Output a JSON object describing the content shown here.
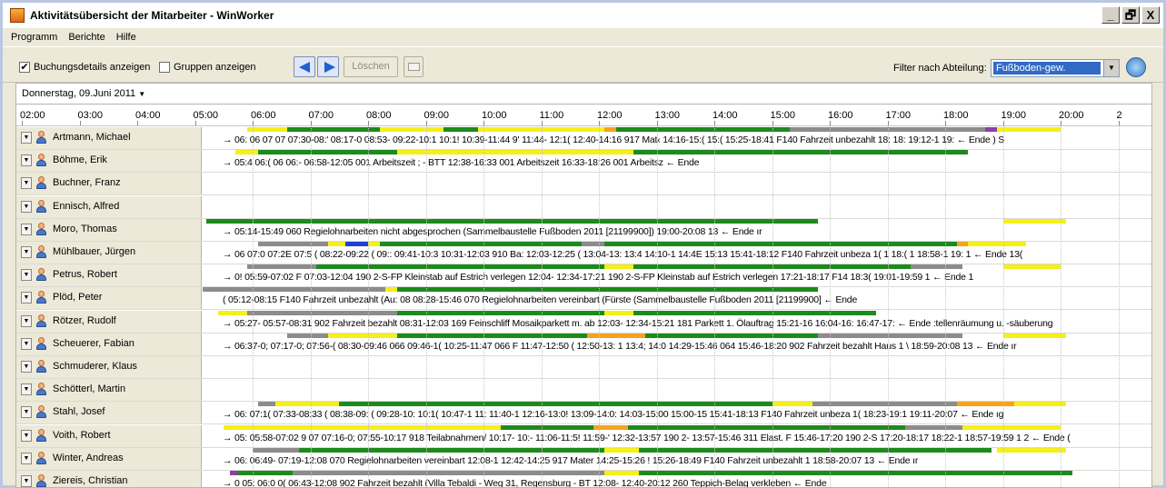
{
  "window": {
    "title": "Aktivitätsübersicht der Mitarbeiter - WinWorker",
    "controls": [
      "_",
      "🗗",
      "X"
    ]
  },
  "menu": [
    "Programm",
    "Berichte",
    "Hilfe"
  ],
  "toolbar": {
    "buchungsdetails_label": "Buchungsdetails anzeigen",
    "buchungsdetails_checked": true,
    "gruppen_label": "Gruppen anzeigen",
    "gruppen_checked": false,
    "loeschen_label": "Löschen",
    "filter_label": "Filter nach Abteilung:",
    "filter_value": "Fußboden-gew."
  },
  "date_label": "Donnerstag, 09.Juni 2011",
  "timeline": {
    "ticks": [
      "02:00",
      "03:00",
      "04:00",
      "05:00",
      "06:00",
      "07:00",
      "08:00",
      "09:00",
      "10:00",
      "11:00",
      "12:00",
      "13:00",
      "14:00",
      "15:00",
      "16:00",
      "17:00",
      "18:00",
      "19:00",
      "20:00",
      "2"
    ]
  },
  "colors": {
    "green": "#1d8a1d",
    "yellow": "#f5ef1a",
    "gray": "#8c8c8c",
    "orange": "#f7a21b",
    "purple": "#8d3fa6",
    "blue": "#2040d8"
  },
  "employees": [
    {
      "name": "Artmann, Michael",
      "text": "→  06: 06 07 07 07:30-08:' 08:17-0 08:53- 09:22-10:1  10:1! 10:39-11:44 9' 11:44- 12:1( 12:40-14:16 917 Mat‹ 14:16-15:( 15:( 15:25-18:41 F140 Fahrzeit unbezahlt            18: 18: 19:12-1 19:  ←  Ende  ) S",
      "bars": [
        {
          "c": "yellow",
          "s": 5.9,
          "e": 6.6
        },
        {
          "c": "green",
          "s": 6.6,
          "e": 8.2
        },
        {
          "c": "yellow",
          "s": 8.2,
          "e": 9.3
        },
        {
          "c": "green",
          "s": 9.3,
          "e": 9.9
        },
        {
          "c": "yellow",
          "s": 9.9,
          "e": 12.1
        },
        {
          "c": "orange",
          "s": 12.1,
          "e": 12.3
        },
        {
          "c": "green",
          "s": 12.3,
          "e": 15.3
        },
        {
          "c": "gray",
          "s": 15.3,
          "e": 18.7
        },
        {
          "c": "purple",
          "s": 18.7,
          "e": 18.9
        },
        {
          "c": "yellow",
          "s": 18.9,
          "e": 20
        }
      ]
    },
    {
      "name": "Böhme, Erik",
      "text": "→  05:4 06:( 06 06:- 06:58-12:05 001 Arbeitszeit                                                      ; - BTT  12:38-16:33 001 Arbeitszeit                              16:33-18:26 001 Arbeitsz ←  Ende",
      "bars": [
        {
          "c": "yellow",
          "s": 5.7,
          "e": 6.1
        },
        {
          "c": "green",
          "s": 6.1,
          "e": 8.5
        },
        {
          "c": "yellow",
          "s": 8.5,
          "e": 12.6
        },
        {
          "c": "green",
          "s": 12.6,
          "e": 18.4
        }
      ]
    },
    {
      "name": "Buchner, Franz",
      "text": "",
      "bars": []
    },
    {
      "name": "Ennisch, Alfred",
      "text": "",
      "bars": []
    },
    {
      "name": "Moro, Thomas",
      "text": "→ 05:14-15:49 060 Regielohnarbeiten nicht abgesprochen (Sammelbaustelle Fußboden 2011 [21199900])                                                                                                                  19:00-20:08 13 ←  Ende  ır",
      "bars": [
        {
          "c": "green",
          "s": 5.2,
          "e": 15.8
        },
        {
          "c": "yellow",
          "s": 19,
          "e": 20.1
        }
      ]
    },
    {
      "name": "Mühlbauer, Jürgen",
      "text": "→  06 07:0 07:2E 07:5 ( 08:22-09:22 ( 09:: 09:41-10:3 10:31-12:03 910 Ba: 12:03-12:25 ( 13:04-13: 13:4 14:10-1 14:4E 15:13 15:41-18:12 F140 Fahrzeit unbeza 1( 1 18:( 1 18:58-1 19: 1 ←  Ende  13(",
      "bars": [
        {
          "c": "gray",
          "s": 6.1,
          "e": 7.3
        },
        {
          "c": "yellow",
          "s": 7.3,
          "e": 7.6
        },
        {
          "c": "blue",
          "s": 7.6,
          "e": 8.0
        },
        {
          "c": "yellow",
          "s": 8.0,
          "e": 8.2
        },
        {
          "c": "green",
          "s": 8.2,
          "e": 11.7
        },
        {
          "c": "gray",
          "s": 11.7,
          "e": 12.1
        },
        {
          "c": "green",
          "s": 12.1,
          "e": 18.2
        },
        {
          "c": "orange",
          "s": 18.2,
          "e": 18.4
        },
        {
          "c": "yellow",
          "s": 18.4,
          "e": 19.4
        }
      ]
    },
    {
      "name": "Petrus, Robert",
      "text": "→  0! 05:59-07:02 F 07:03-12:04 190 2-S-FP Kleinstab auf Estrich verlegen                     12:04- 12:34-17:21 190 2-S-FP Kleinstab auf Estrich verlegen              17:21-18:17 F14 18:3( 19:01-19:59 1 ←  Ende  1",
      "bars": [
        {
          "c": "gray",
          "s": 5.9,
          "e": 7.1
        },
        {
          "c": "green",
          "s": 7.1,
          "e": 12.1
        },
        {
          "c": "yellow",
          "s": 12.1,
          "e": 12.6
        },
        {
          "c": "green",
          "s": 12.6,
          "e": 17.4
        },
        {
          "c": "gray",
          "s": 17.4,
          "e": 18.3
        },
        {
          "c": "yellow",
          "s": 19,
          "e": 20
        }
      ]
    },
    {
      "name": "Plöd, Peter",
      "text": "( 05:12-08:15 F140 Fahrzeit unbezahlt (Au: 08 08:28-15:46 070 Regielohnarbeiten vereinbart (Fürste (Sammelbaustelle Fußboden 2011 [21199900] ←  Ende",
      "bars": [
        {
          "c": "purple",
          "s": 5.0,
          "e": 5.05
        },
        {
          "c": "gray",
          "s": 5.1,
          "e": 8.3
        },
        {
          "c": "yellow",
          "s": 8.3,
          "e": 8.5
        },
        {
          "c": "green",
          "s": 8.5,
          "e": 15.8
        }
      ]
    },
    {
      "name": "Rötzer, Rudolf",
      "text": "→  05:27- 05:57-08:31 902 Fahrzeit bezahlt  08:31-12:03 169 Feinschliff Mosaikparkett m. ab 12:03- 12:34-15:21 181 Parkett 1. Ölauftrag  15:21-16 16:04-16: 16:47-17: ←  Ende  :tellenräumung u. -säuberung",
      "bars": [
        {
          "c": "yellow",
          "s": 5.4,
          "e": 5.9
        },
        {
          "c": "gray",
          "s": 5.9,
          "e": 8.5
        },
        {
          "c": "green",
          "s": 8.5,
          "e": 12.1
        },
        {
          "c": "yellow",
          "s": 12.1,
          "e": 12.6
        },
        {
          "c": "green",
          "s": 12.6,
          "e": 16.8
        }
      ]
    },
    {
      "name": "Scheuerer, Fabian",
      "text": "→  06:37-0; 07:17-0; 07:56-( 08:30-09:46 066 09:46-1( 10:25-11:47 066 F 11:47-12:50 ( 12:50-13: 1 13:4; 14:0 14:29-15:46 064  15:46-18:20 902 Fahrzeit bezahlt  Haus 1 \\ 18:59-20:08 13 ←  Ende  ır",
      "bars": [
        {
          "c": "gray",
          "s": 6.6,
          "e": 7.3
        },
        {
          "c": "yellow",
          "s": 7.3,
          "e": 8.5
        },
        {
          "c": "green",
          "s": 8.5,
          "e": 11.8
        },
        {
          "c": "orange",
          "s": 11.8,
          "e": 12.8
        },
        {
          "c": "green",
          "s": 12.8,
          "e": 15.8
        },
        {
          "c": "gray",
          "s": 15.8,
          "e": 18.3
        },
        {
          "c": "yellow",
          "s": 19,
          "e": 20.1
        }
      ]
    },
    {
      "name": "Schmuderer, Klaus",
      "text": "",
      "bars": []
    },
    {
      "name": "Schötterl, Martin",
      "text": "",
      "bars": []
    },
    {
      "name": "Stahl, Josef",
      "text": "→  06: 07:1( 07:33-08:33 ( 08:38-09: ( 09:28-10: 10:1( 10:47-1 11: 11:40-1 12:16-13:0! 13:09-14:0: 14:03-15:00  15:00-15 15:41-18:13 F140 Fahrzeit unbeza 1( 18:23-19:1 19:11-20:07 ←  Ende  ıg",
      "bars": [
        {
          "c": "gray",
          "s": 6.1,
          "e": 6.4
        },
        {
          "c": "yellow",
          "s": 6.4,
          "e": 7.5
        },
        {
          "c": "green",
          "s": 7.5,
          "e": 15.0
        },
        {
          "c": "yellow",
          "s": 15.0,
          "e": 15.7
        },
        {
          "c": "gray",
          "s": 15.7,
          "e": 18.2
        },
        {
          "c": "orange",
          "s": 18.2,
          "e": 19.2
        },
        {
          "c": "yellow",
          "s": 19.2,
          "e": 20.1
        }
      ]
    },
    {
      "name": "Voith, Robert",
      "text": "→  05: 05:58-07:02 9 07 07:16-0; 07:55-10:17 918 Teilabnahmen/ 10:17- 10:- 11:06-11:5! 11:59-' 12:32-13:57 190 2- 13:57-15:46 311 Elast. F 15:46-17:20 190 2-S 17:20-18:17  18:22-1 18:57-19:59 1 2 ←  Ende  (",
      "bars": [
        {
          "c": "yellow",
          "s": 5.5,
          "e": 10.3
        },
        {
          "c": "green",
          "s": 10.3,
          "e": 11.9
        },
        {
          "c": "orange",
          "s": 11.9,
          "e": 12.5
        },
        {
          "c": "green",
          "s": 12.5,
          "e": 17.3
        },
        {
          "c": "gray",
          "s": 17.3,
          "e": 18.3
        },
        {
          "c": "yellow",
          "s": 18.3,
          "e": 20
        }
      ]
    },
    {
      "name": "Winter, Andreas",
      "text": "→  06: 06:49- 07:19-12:08 070 Regielohnarbeiten vereinbart                                    12:08-1 12:42-14:25 917 Mater 14:25-15:26 ! 15:26-18:49 F140 Fahrzeit unbezahlt              1 18:58-20:07 13 ←  Ende  ır",
      "bars": [
        {
          "c": "gray",
          "s": 6.0,
          "e": 6.8
        },
        {
          "c": "green",
          "s": 6.8,
          "e": 12.1
        },
        {
          "c": "yellow",
          "s": 12.1,
          "e": 12.7
        },
        {
          "c": "green",
          "s": 12.7,
          "e": 18.8
        },
        {
          "c": "yellow",
          "s": 18.9,
          "e": 20.1
        }
      ]
    },
    {
      "name": "Ziereis, Christian",
      "text": "→  0 05: 06:0 0( 06:43-12:08 902 Fahrzeit bezahlt (Villa Tebaldi - Weg 31, Regensburg - BT 12:08- 12:40-20:12 260 Teppich-Belag verkleben                                                                    ←  Ende",
      "bars": [
        {
          "c": "purple",
          "s": 5.6,
          "e": 5.75
        },
        {
          "c": "green",
          "s": 5.75,
          "e": 6.7
        },
        {
          "c": "gray",
          "s": 6.7,
          "e": 12.1
        },
        {
          "c": "yellow",
          "s": 12.1,
          "e": 12.7
        },
        {
          "c": "green",
          "s": 12.7,
          "e": 20.2
        }
      ]
    }
  ]
}
